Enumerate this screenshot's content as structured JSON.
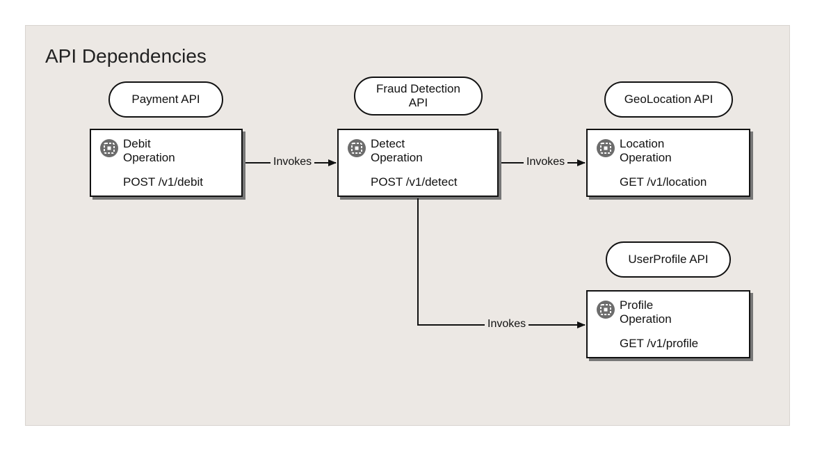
{
  "diagram": {
    "title": "API Dependencies",
    "apis": {
      "payment": {
        "label": "Payment API",
        "operation_name": "Debit\nOperation",
        "operation_path": "POST /v1/debit"
      },
      "fraud": {
        "label": "Fraud Detection\nAPI",
        "operation_name": "Detect\nOperation",
        "operation_path": "POST /v1/detect"
      },
      "geo": {
        "label": "GeoLocation API",
        "operation_name": "Location\nOperation",
        "operation_path": "GET /v1/location"
      },
      "profile": {
        "label": "UserProfile API",
        "operation_name": "Profile\nOperation",
        "operation_path": "GET /v1/profile"
      }
    },
    "edges": {
      "e1": {
        "label": "Invokes"
      },
      "e2": {
        "label": "Invokes"
      },
      "e3": {
        "label": "Invokes"
      }
    }
  }
}
